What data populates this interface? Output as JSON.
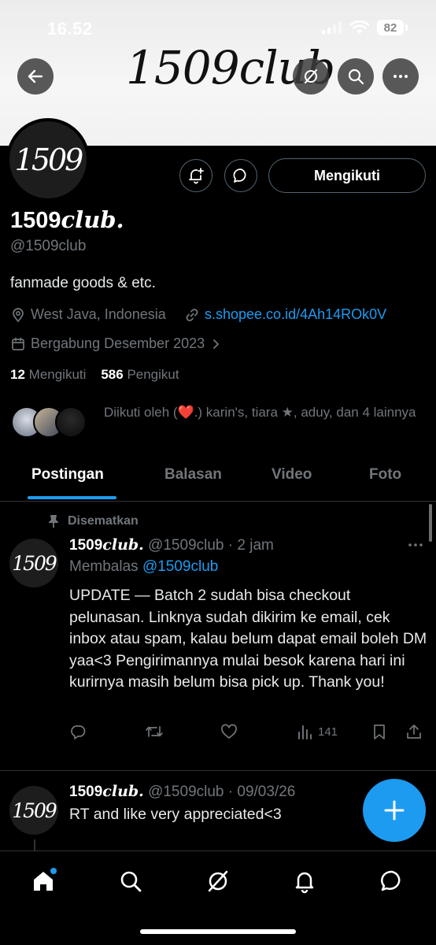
{
  "status_bar": {
    "time": "16.52",
    "battery": "82"
  },
  "banner": {
    "handwriting": "1509club"
  },
  "profile": {
    "avatar_text": "1509",
    "display_name_num": "1509",
    "display_name_word": "club.",
    "handle": "@1509club",
    "bio": "fanmade goods & etc.",
    "location": "West Java, Indonesia",
    "link": "s.shopee.co.id/4Ah14ROk0V",
    "joined": "Bergabung Desember 2023",
    "following_count": "12",
    "following_label": "Mengikuti",
    "followers_count": "586",
    "followers_label": "Pengikut",
    "followed_by": "Diikuti oleh (❤️.) karin's, tiara ★, aduy, dan 4 lainnya",
    "follow_button": "Mengikuti"
  },
  "tabs": [
    {
      "label": "Postingan",
      "active": true
    },
    {
      "label": "Balasan",
      "active": false
    },
    {
      "label": "Video",
      "active": false
    },
    {
      "label": "Foto",
      "active": false
    }
  ],
  "tweets": [
    {
      "pinned_label": "Disematkan",
      "name_num": "1509",
      "name_word": "club.",
      "handle": "@1509club",
      "time": "2 jam",
      "reply_prefix": "Membalas",
      "reply_handle": "@1509club",
      "text": "UPDATE — Batch 2 sudah bisa checkout pelunasan. Linknya sudah dikirim ke email, cek inbox atau spam, kalau belum dapat email boleh DM yaa<3 Pengirimannya mulai besok karena hari ini kurirnya masih belum bisa pick up. Thank you!",
      "views": "141"
    },
    {
      "name_num": "1509",
      "name_word": "club.",
      "handle": "@1509club",
      "time": "09/03/26",
      "text": "RT and like very appreciated<3"
    }
  ],
  "colors": {
    "accent": "#1d9bf0",
    "muted": "#71767b",
    "background": "#000000"
  },
  "icons": [
    "back-arrow-icon",
    "grok-icon",
    "search-icon",
    "more-icon",
    "notify-add-icon",
    "message-icon",
    "location-icon",
    "link-icon",
    "calendar-icon",
    "chevron-right-icon",
    "pin-icon",
    "reply-icon",
    "retweet-icon",
    "like-icon",
    "views-icon",
    "bookmark-icon",
    "share-icon",
    "compose-plus-icon",
    "home-icon",
    "explore-icon",
    "notifications-icon",
    "messages-icon"
  ]
}
